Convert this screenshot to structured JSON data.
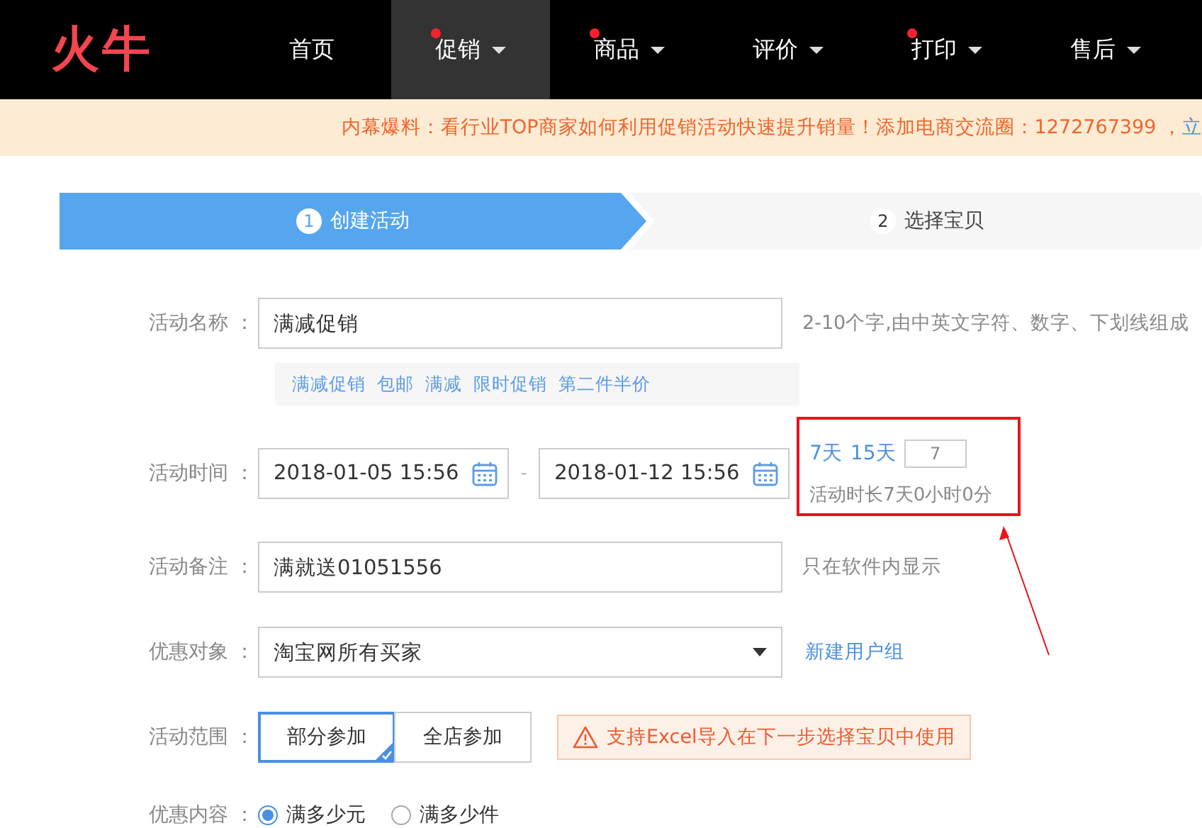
{
  "logo": "火牛",
  "nav": [
    {
      "label": "首页",
      "selected": false,
      "dot": false,
      "dropdown": false
    },
    {
      "label": "促销",
      "selected": true,
      "dot": true,
      "dropdown": true
    },
    {
      "label": "商品",
      "selected": false,
      "dot": true,
      "dropdown": true
    },
    {
      "label": "评价",
      "selected": false,
      "dot": false,
      "dropdown": true
    },
    {
      "label": "打印",
      "selected": false,
      "dot": true,
      "dropdown": true
    },
    {
      "label": "售后",
      "selected": false,
      "dot": false,
      "dropdown": true
    }
  ],
  "banner": {
    "text": "内幕爆料：看行业TOP商家如何利用促销活动快速提升销量！添加电商交流圈：1272767399 ，",
    "link": "立"
  },
  "steps": [
    {
      "number": "1",
      "label": "创建活动",
      "selected": true
    },
    {
      "number": "2",
      "label": "选择宝贝",
      "selected": false
    }
  ],
  "activity_name": {
    "label": "活动名称 ：",
    "value": "满减促销",
    "hint": "2-10个字,由中英文字符、数字、下划线组成",
    "tags": [
      "满减促销",
      "包邮",
      "满减",
      "限时促销",
      "第二件半价"
    ]
  },
  "activity_time": {
    "label": "活动时间 ：",
    "start": "2018-01-05 15:56",
    "separator": "-",
    "end": "2018-01-12 15:56",
    "presets": [
      "7天",
      "15天"
    ],
    "days": "7",
    "duration": "活动时长7天0小时0分"
  },
  "note": {
    "label": "活动备注 ：",
    "value": "满就送01051556",
    "hint": "只在软件内显示"
  },
  "target": {
    "label": "优惠对象 ：",
    "value": "淘宝网所有买家",
    "link": "新建用户组"
  },
  "scope": {
    "label": "活动范围 ：",
    "options": [
      {
        "label": "部分参加",
        "selected": true
      },
      {
        "label": "全店参加",
        "selected": false
      }
    ],
    "notice": "支持Excel导入在下一步选择宝贝中使用"
  },
  "content": {
    "label": "优惠内容 ：",
    "options": [
      {
        "label": "满多少元",
        "selected": true
      },
      {
        "label": "满多少件",
        "selected": false
      }
    ]
  }
}
